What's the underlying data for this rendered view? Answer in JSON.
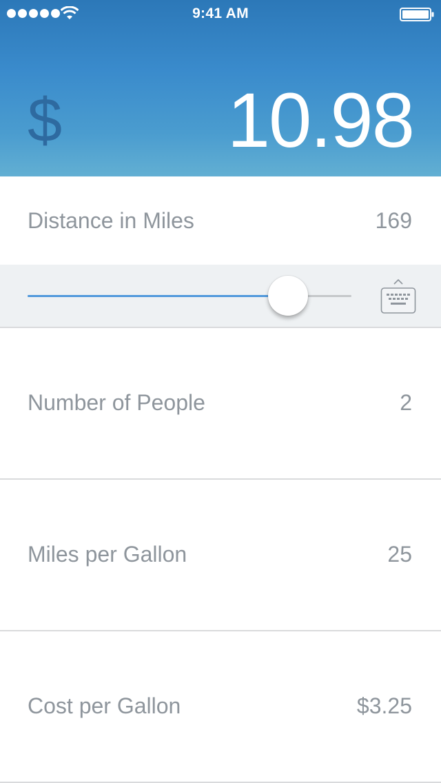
{
  "status_bar": {
    "time": "9:41 AM",
    "signal_icon": "signal-dots-icon",
    "wifi_icon": "wifi-icon",
    "battery_icon": "battery-icon"
  },
  "header": {
    "currency_symbol": "$",
    "total": "10.98"
  },
  "rows": [
    {
      "label": "Distance in Miles",
      "value": "169"
    },
    {
      "label": "Number of People",
      "value": "2"
    },
    {
      "label": "Miles per Gallon",
      "value": "25"
    },
    {
      "label": "Cost per Gallon",
      "value": "$3.25"
    }
  ],
  "slider": {
    "fraction": 0.804,
    "keyboard_icon": "keyboard-icon"
  },
  "colors": {
    "header_top": "#2c78b8",
    "header_bottom": "#62afd3",
    "slider_fill": "#4f98dc",
    "label_text": "#8e959c",
    "currency_symbol": "#2e6aa0"
  }
}
